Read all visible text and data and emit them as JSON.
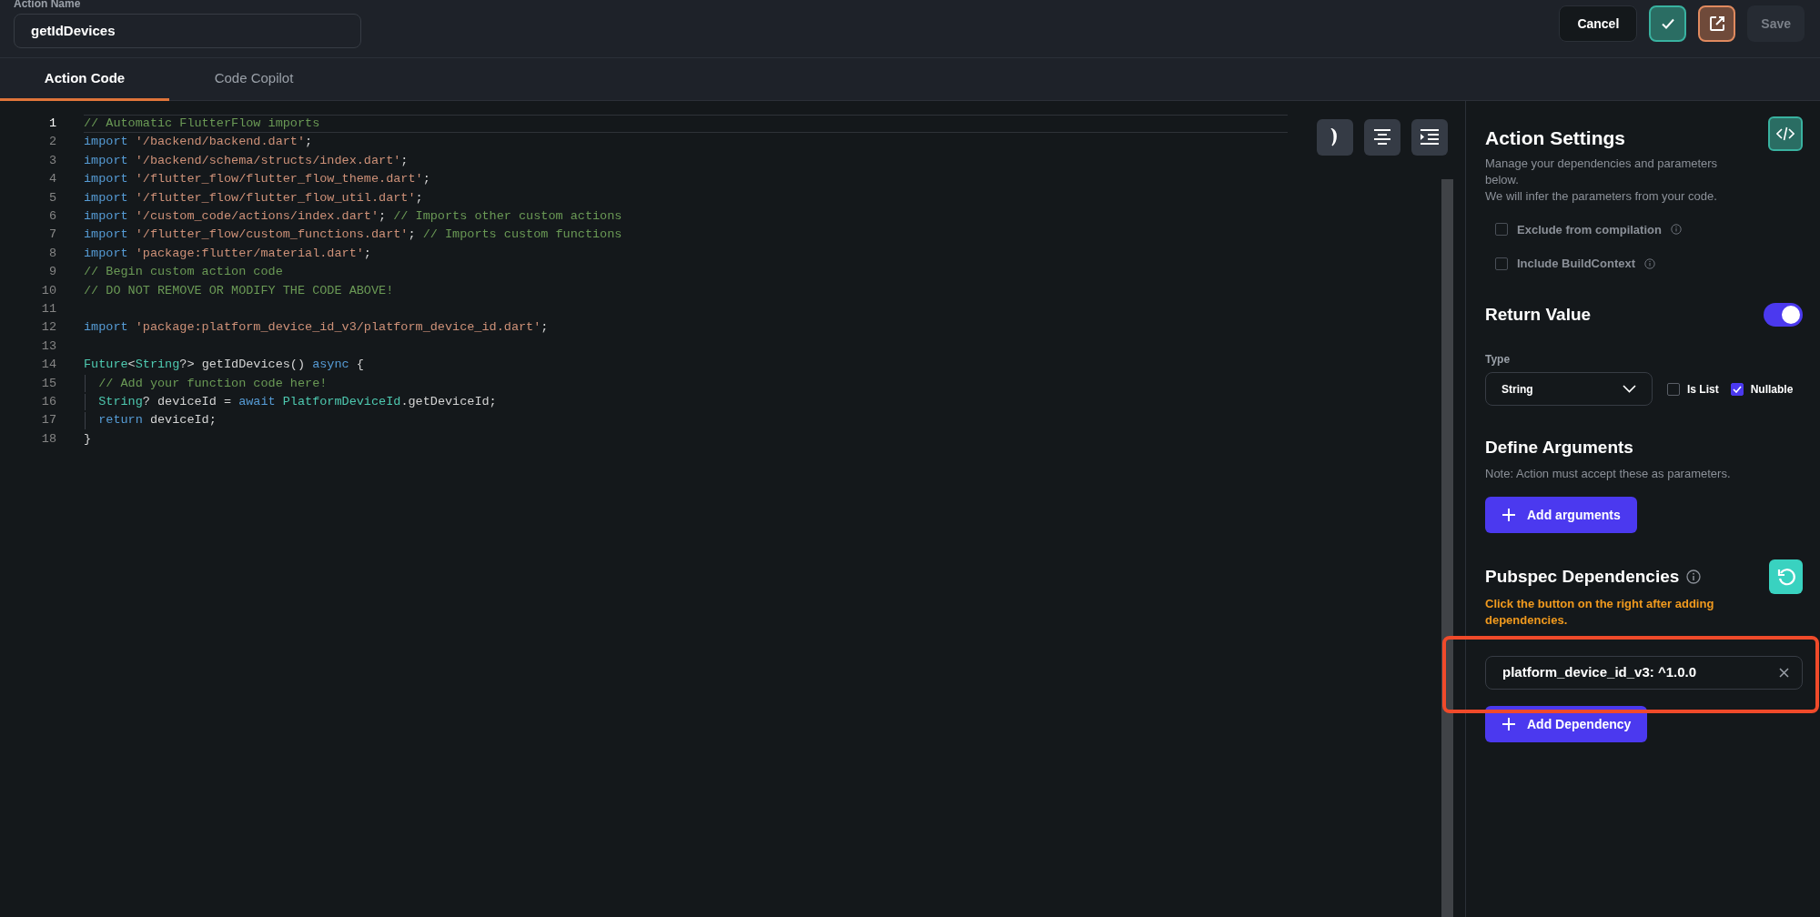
{
  "header": {
    "label": "Action Name",
    "action_name": "getIdDevices",
    "cancel": "Cancel",
    "save": {
      "label": "Save",
      "disabled": true
    }
  },
  "tabs": [
    {
      "label": "Action Code",
      "selected": true
    },
    {
      "label": "Code Copilot",
      "selected": false
    }
  ],
  "editor": {
    "lines": [
      {
        "number": "1",
        "current": true,
        "guide": false,
        "tokens": [
          {
            "kind": "comment",
            "text": "// Automatic FlutterFlow imports"
          }
        ]
      },
      {
        "number": "2",
        "current": false,
        "guide": false,
        "tokens": [
          {
            "kind": "keyword",
            "text": "import"
          },
          {
            "kind": "string",
            "text": " '/backend/backend.dart'"
          },
          {
            "kind": "plain",
            "text": ";"
          }
        ]
      },
      {
        "number": "3",
        "current": false,
        "guide": false,
        "tokens": [
          {
            "kind": "keyword",
            "text": "import"
          },
          {
            "kind": "string",
            "text": " '/backend/schema/structs/index.dart'"
          },
          {
            "kind": "plain",
            "text": ";"
          }
        ]
      },
      {
        "number": "4",
        "current": false,
        "guide": false,
        "tokens": [
          {
            "kind": "keyword",
            "text": "import"
          },
          {
            "kind": "string",
            "text": " '/flutter_flow/flutter_flow_theme.dart'"
          },
          {
            "kind": "plain",
            "text": ";"
          }
        ]
      },
      {
        "number": "5",
        "current": false,
        "guide": false,
        "tokens": [
          {
            "kind": "keyword",
            "text": "import"
          },
          {
            "kind": "string",
            "text": " '/flutter_flow/flutter_flow_util.dart'"
          },
          {
            "kind": "plain",
            "text": ";"
          }
        ]
      },
      {
        "number": "6",
        "current": false,
        "guide": false,
        "tokens": [
          {
            "kind": "keyword",
            "text": "import"
          },
          {
            "kind": "string",
            "text": " '/custom_code/actions/index.dart'"
          },
          {
            "kind": "plain",
            "text": "; "
          },
          {
            "kind": "comment",
            "text": "// Imports other custom actions"
          }
        ]
      },
      {
        "number": "7",
        "current": false,
        "guide": false,
        "tokens": [
          {
            "kind": "keyword",
            "text": "import"
          },
          {
            "kind": "string",
            "text": " '/flutter_flow/custom_functions.dart'"
          },
          {
            "kind": "plain",
            "text": "; "
          },
          {
            "kind": "comment",
            "text": "// Imports custom functions"
          }
        ]
      },
      {
        "number": "8",
        "current": false,
        "guide": false,
        "tokens": [
          {
            "kind": "keyword",
            "text": "import"
          },
          {
            "kind": "string",
            "text": " 'package:flutter/material.dart'"
          },
          {
            "kind": "plain",
            "text": ";"
          }
        ]
      },
      {
        "number": "9",
        "current": false,
        "guide": false,
        "tokens": [
          {
            "kind": "comment",
            "text": "// Begin custom action code"
          }
        ]
      },
      {
        "number": "10",
        "current": false,
        "guide": false,
        "tokens": [
          {
            "kind": "comment",
            "text": "// DO NOT REMOVE OR MODIFY THE CODE ABOVE!"
          }
        ]
      },
      {
        "number": "11",
        "current": false,
        "guide": false
      },
      {
        "number": "12",
        "current": false,
        "guide": false,
        "tokens": [
          {
            "kind": "keyword",
            "text": "import"
          },
          {
            "kind": "string",
            "text": " 'package:platform_device_id_v3/platform_device_id.dart'"
          },
          {
            "kind": "plain",
            "text": ";"
          }
        ]
      },
      {
        "number": "13",
        "current": false,
        "guide": false
      },
      {
        "number": "14",
        "current": false,
        "guide": false,
        "tokens": [
          {
            "kind": "type",
            "text": "Future"
          },
          {
            "kind": "plain",
            "text": "<"
          },
          {
            "kind": "type",
            "text": "String"
          },
          {
            "kind": "plain",
            "text": "?> getIdDevices() "
          },
          {
            "kind": "keyword",
            "text": "async"
          },
          {
            "kind": "plain",
            "text": " {"
          }
        ]
      },
      {
        "number": "15",
        "current": false,
        "guide": true,
        "tokens": [
          {
            "kind": "comment",
            "text": "  // Add your function code here!"
          }
        ]
      },
      {
        "number": "16",
        "current": false,
        "guide": true,
        "tokens": [
          {
            "kind": "type",
            "text": "  String"
          },
          {
            "kind": "plain",
            "text": "? deviceId = "
          },
          {
            "kind": "keyword",
            "text": "await"
          },
          {
            "kind": "type",
            "text": " PlatformDeviceId"
          },
          {
            "kind": "plain",
            "text": ".getDeviceId;"
          }
        ]
      },
      {
        "number": "17",
        "current": false,
        "guide": true,
        "tokens": [
          {
            "kind": "keyword",
            "text": "  return"
          },
          {
            "kind": "plain",
            "text": " deviceId;"
          }
        ]
      },
      {
        "number": "18",
        "current": false,
        "guide": false,
        "tokens": [
          {
            "kind": "plain",
            "text": "}"
          }
        ]
      }
    ]
  },
  "settings": {
    "title": "Action Settings",
    "description": [
      "Manage your dependencies and parameters below.",
      "We will infer the parameters from your code."
    ],
    "options": [
      {
        "label": "Exclude from compilation",
        "checked": false
      },
      {
        "label": "Include BuildContext",
        "checked": false
      }
    ],
    "return_value": {
      "title": "Return Value",
      "on": true,
      "type_label": "Type",
      "type": "String",
      "flags": [
        {
          "label": "Is List",
          "checked": false
        },
        {
          "label": "Nullable",
          "checked": true
        }
      ]
    },
    "arguments": {
      "title": "Define Arguments",
      "note": "Note: Action must accept these as parameters.",
      "button": "Add arguments"
    },
    "pubspec": {
      "title": "Pubspec Dependencies",
      "warning": "Click the button on the right after adding dependencies.",
      "dependencies": [
        {
          "value": "platform_device_id_v3: ^1.0.0"
        }
      ],
      "button": "Add Dependency"
    }
  }
}
